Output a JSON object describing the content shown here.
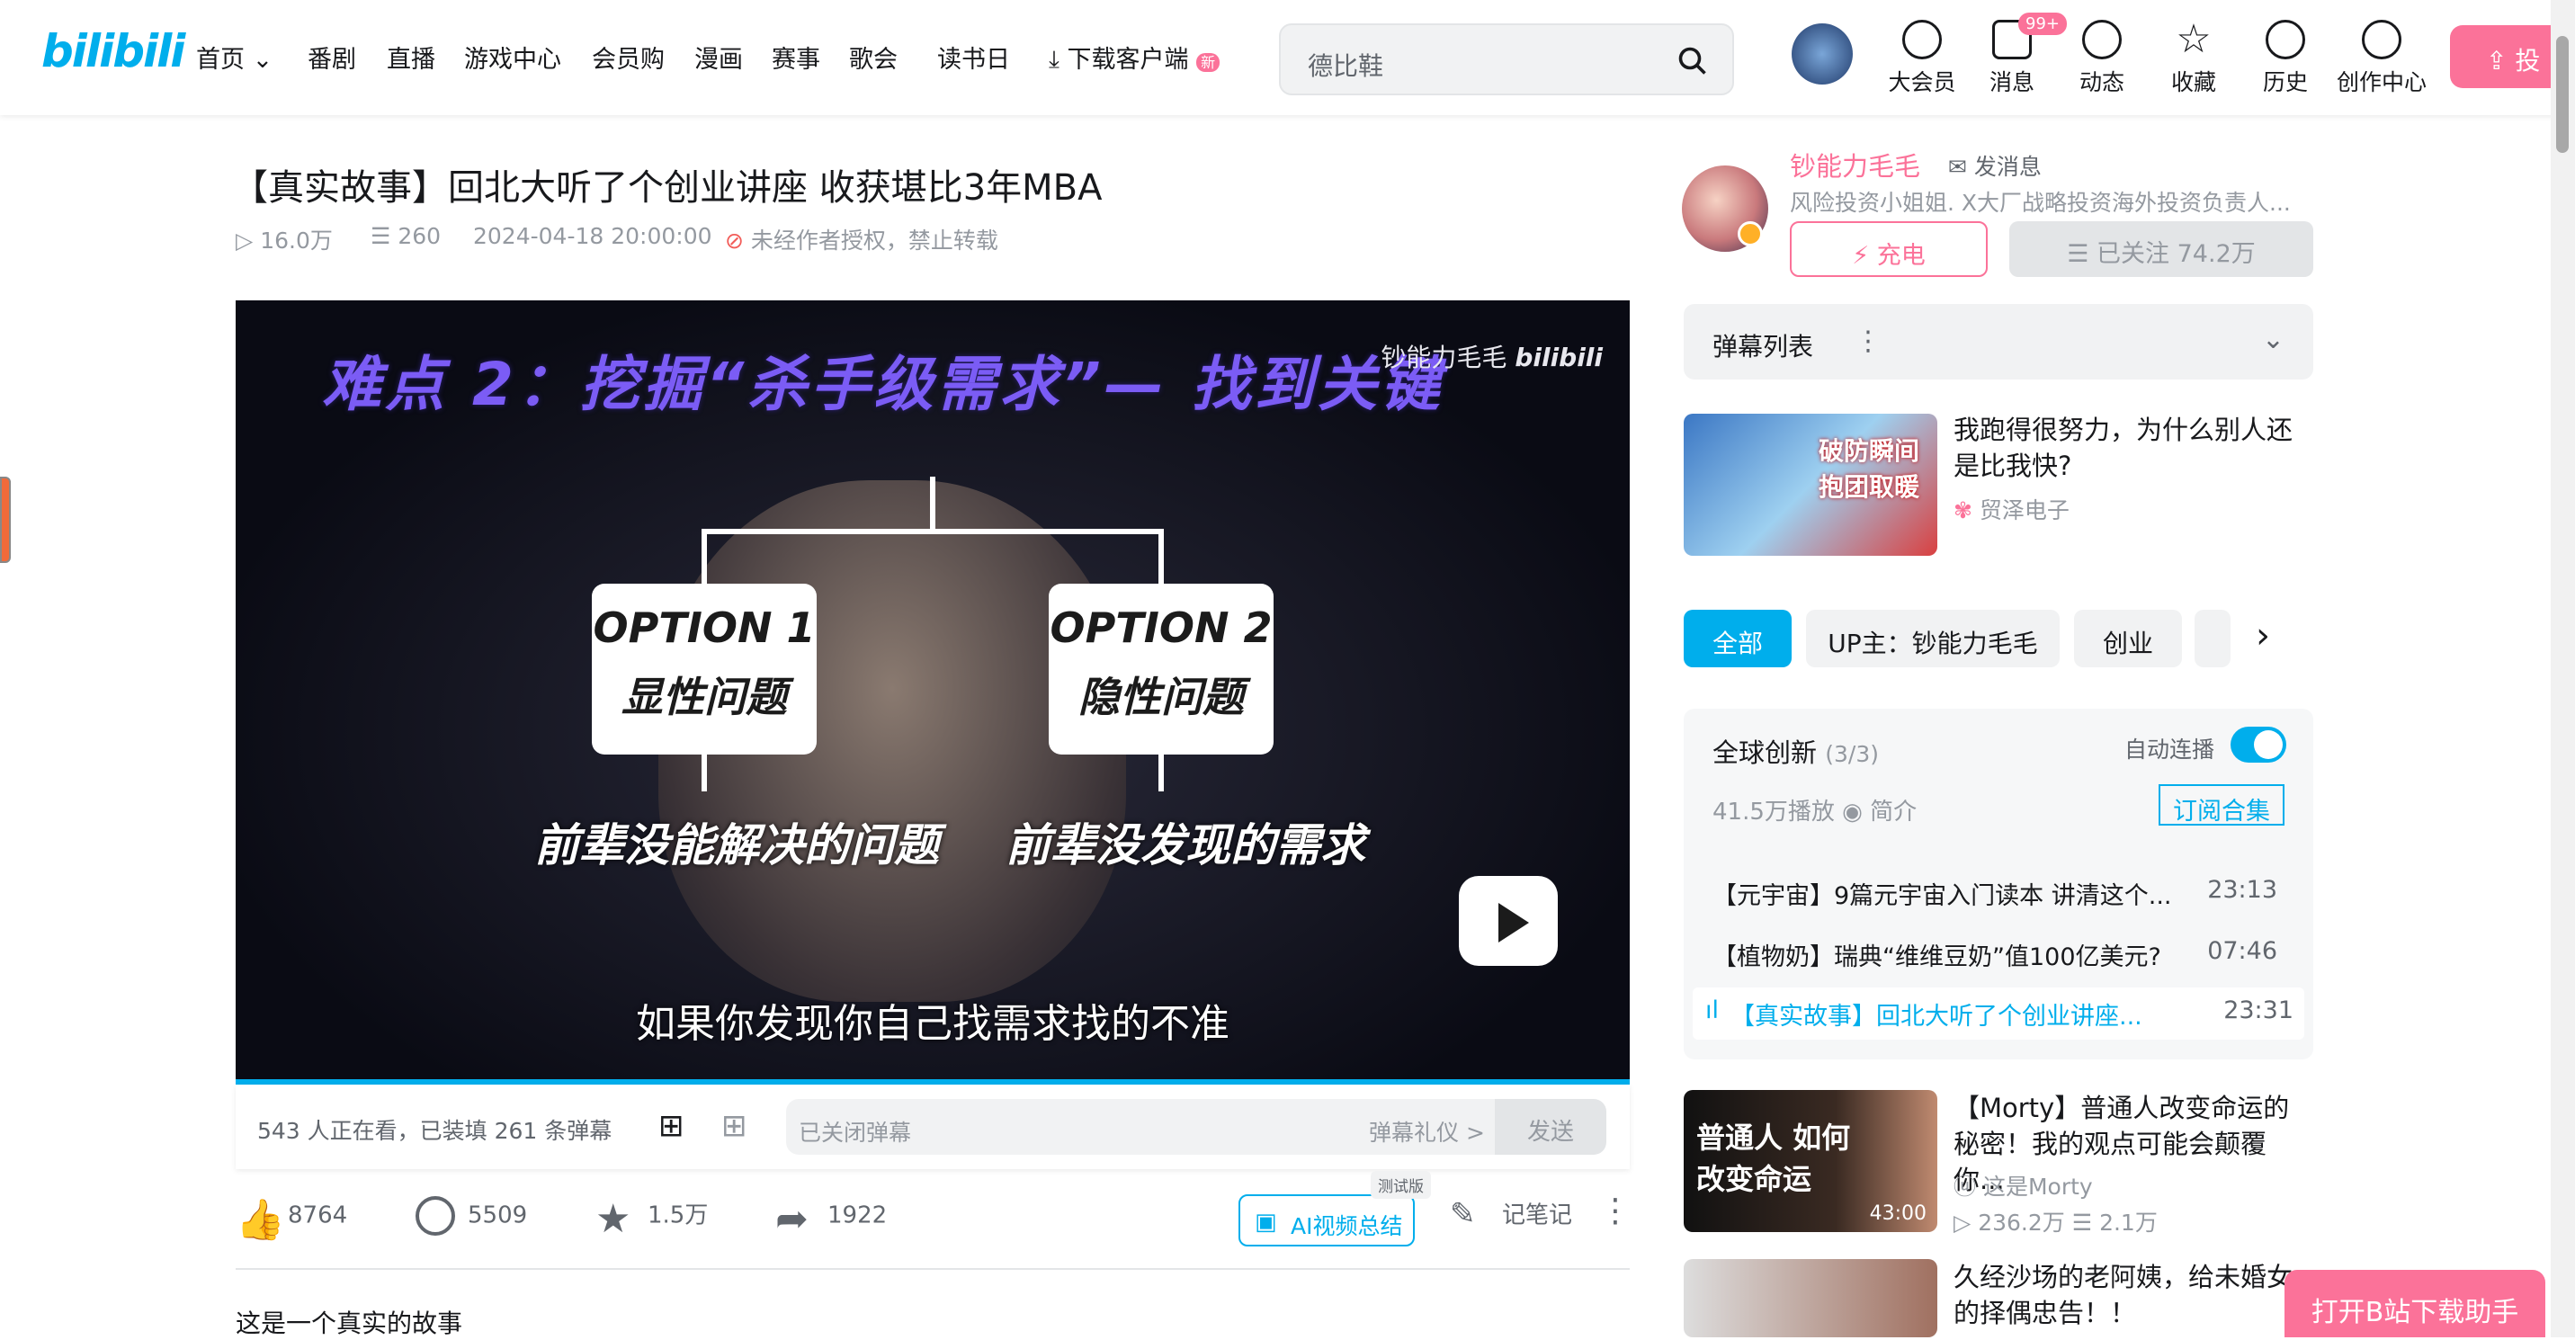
{
  "header": {
    "logo": "bilibili",
    "nav": [
      "首页",
      "番剧",
      "直播",
      "游戏中心",
      "会员购",
      "漫画",
      "赛事",
      "歌会",
      "读书日",
      "下载客户端"
    ],
    "new_badge": "新",
    "search_placeholder": "德比鞋",
    "icons": [
      {
        "label": "大会员",
        "icon": "vip-icon"
      },
      {
        "label": "消息",
        "icon": "message-icon",
        "badge": "99+"
      },
      {
        "label": "动态",
        "icon": "dynamic-icon"
      },
      {
        "label": "收藏",
        "icon": "star-icon"
      },
      {
        "label": "历史",
        "icon": "clock-icon"
      },
      {
        "label": "创作中心",
        "icon": "bulb-icon"
      }
    ],
    "upload_label": "投"
  },
  "video": {
    "title": "【真实故事】回北大听了个创业讲座 收获堪比3年MBA",
    "views": "16.0万",
    "danmaku": "260",
    "date": "2024-04-18 20:00:00",
    "copyright": "未经作者授权，禁止转载",
    "frame": {
      "headline": "难点 2：挖掘“杀手级需求”— 找到关键",
      "watermark": "钞能力毛毛",
      "option1_title": "OPTION 1",
      "option1_sub": "显性问题",
      "option2_title": "OPTION 2",
      "option2_sub": "隐性问题",
      "sub1": "前辈没能解决的问题",
      "sub2": "前辈没发现的需求",
      "caption": "如果你发现你自己找需求找的不准"
    },
    "progress": 0.0
  },
  "danmu_bar": {
    "viewers": "543 人正在看，已装填 261 条弹幕",
    "input_placeholder": "已关闭弹幕",
    "etiquette": "弹幕礼仪 >",
    "send": "发送"
  },
  "actions": {
    "like": "8764",
    "coin": "5509",
    "fav": "1.5万",
    "share": "1922",
    "ai_summary": "AI视频总结",
    "test_badge": "测试版",
    "notes": "记笔记"
  },
  "description": "这是一个真实的故事",
  "uploader": {
    "name": "钞能力毛毛",
    "send_message": "发消息",
    "desc": "风险投资小姐姐. X大厂战略投资海外投资负责人...",
    "charge": "充电",
    "followed": "已关注 74.2万"
  },
  "danmaku_list_label": "弹幕列表",
  "recommend_top": {
    "title": "我跑得很努力，为什么别人还是比我快?",
    "author": "贸泽电子",
    "thumb_text": "破防瞬间 抱团取暖"
  },
  "tabs": [
    "全部",
    "UP主：钞能力毛毛",
    "创业"
  ],
  "collection": {
    "title": "全球创新",
    "count": "(3/3)",
    "autoplay": "自动连播",
    "plays": "41.5万播放",
    "intro": "简介",
    "subscribe": "订阅合集",
    "episodes": [
      {
        "title": "【元宇宙】9篇元宇宙入门读本 讲清这个...",
        "duration": "23:13"
      },
      {
        "title": "【植物奶】瑞典“维维豆奶”值100亿美元?",
        "duration": "07:46"
      },
      {
        "title": "【真实故事】回北大听了个创业讲座...",
        "duration": "23:31"
      }
    ]
  },
  "recommend": [
    {
      "title": "【Morty】普通人改变命运的秘密！我的观点可能会颠覆你...",
      "author": "这是Morty",
      "views": "236.2万",
      "danmaku": "2.1万",
      "duration": "43:00",
      "thumb_text": "普通人 如何改变命运"
    },
    {
      "title": "久经沙场的老阿姨，给未婚女的择偶忠告！！"
    }
  ],
  "open_app": "打开B站下载助手",
  "colors": {
    "accent": "#00aeec",
    "pink": "#fb7299"
  }
}
